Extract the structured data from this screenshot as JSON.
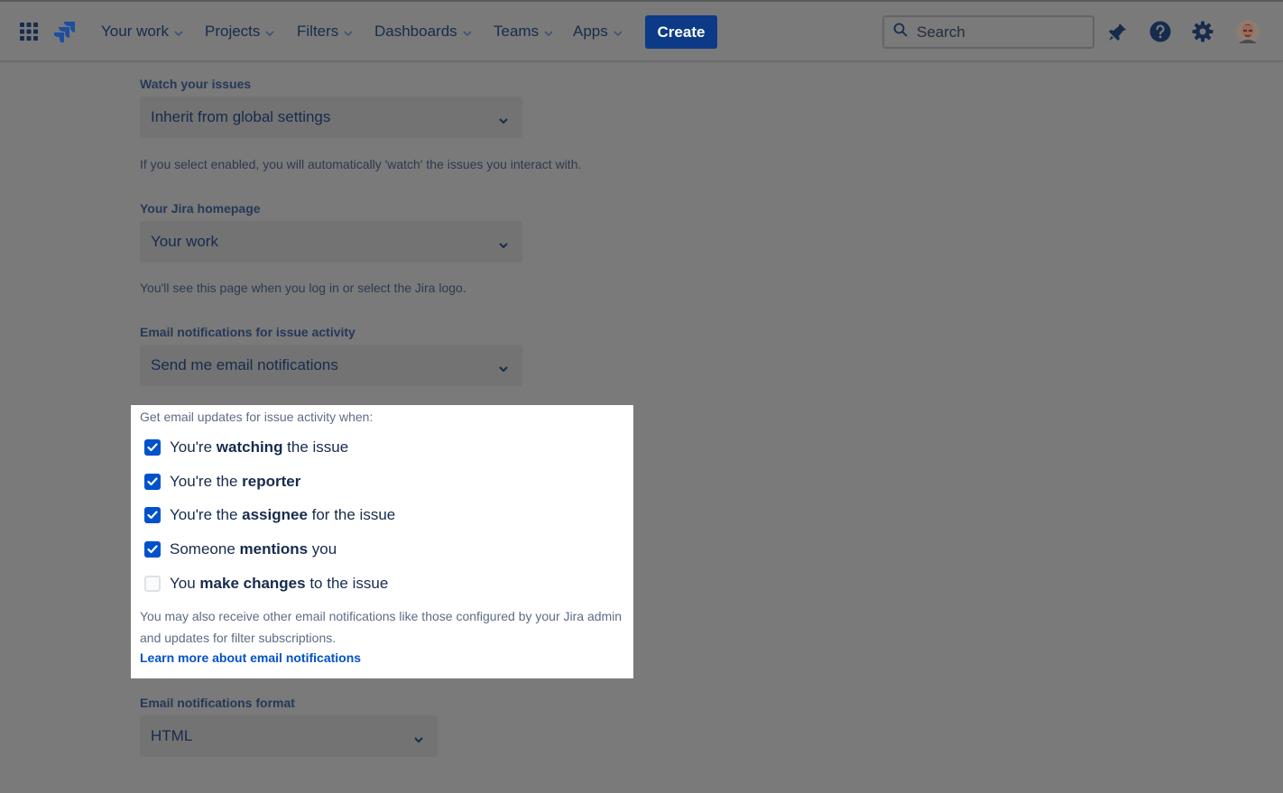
{
  "colors": {
    "accent": "#0052cc",
    "create_button": "#0c3a87"
  },
  "nav": {
    "items": [
      {
        "label": "Your work",
        "icon": "chevron-down-icon"
      },
      {
        "label": "Projects",
        "icon": "chevron-down-icon"
      },
      {
        "label": "Filters",
        "icon": "chevron-down-icon"
      },
      {
        "label": "Dashboards",
        "icon": "chevron-down-icon"
      },
      {
        "label": "Teams",
        "icon": "chevron-down-icon"
      },
      {
        "label": "Apps",
        "icon": "chevron-down-icon"
      }
    ],
    "create_label": "Create",
    "search_placeholder": "Search",
    "icons": [
      "app-switcher-icon",
      "jira-logo-icon",
      "search-icon",
      "notifications-icon",
      "help-icon",
      "settings-icon",
      "avatar"
    ]
  },
  "form": {
    "watch": {
      "label": "Watch your issues",
      "value": "Inherit from global settings",
      "helper": "If you select enabled, you will automatically 'watch' the issues you interact with."
    },
    "homepage": {
      "label": "Your Jira homepage",
      "value": "Your work",
      "helper": "You'll see this page when you log in or select the Jira logo."
    },
    "email_activity": {
      "label": "Email notifications for issue activity",
      "value": "Send me email notifications"
    },
    "updates": {
      "intro": "Get email updates for issue activity when:",
      "options": [
        {
          "pre": "You're ",
          "bold": "watching",
          "post": " the issue",
          "checked": true
        },
        {
          "pre": "You're the ",
          "bold": "reporter",
          "post": "",
          "checked": true
        },
        {
          "pre": "You're the ",
          "bold": "assignee",
          "post": " for the issue",
          "checked": true
        },
        {
          "pre": "Someone ",
          "bold": "mentions",
          "post": " you",
          "checked": true
        },
        {
          "pre": "You ",
          "bold": "make changes",
          "post": " to the issue",
          "checked": false
        }
      ],
      "note": "You may also receive other email notifications like those configured by your Jira admin and updates for filter subscriptions.",
      "learn_more": "Learn more about email notifications"
    },
    "format": {
      "label": "Email notifications format",
      "value": "HTML"
    }
  }
}
